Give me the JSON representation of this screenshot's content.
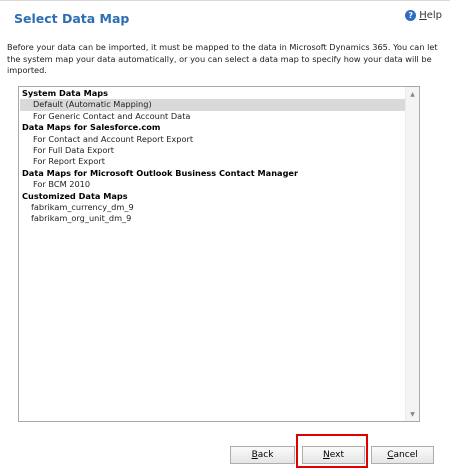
{
  "header": {
    "title": "Select Data Map",
    "help_label": "Help",
    "help_icon": "?"
  },
  "description": "Before your data can be imported, it must be mapped to the data in Microsoft Dynamics 365. You can let the system map your data automatically, or you can select a data map to specify how your data will be imported.",
  "list": {
    "groups": [
      {
        "label": "System Data Maps",
        "items": [
          "Default (Automatic Mapping)",
          "For Generic Contact and Account Data"
        ]
      },
      {
        "label": "Data Maps for Salesforce.com",
        "items": [
          "For Contact and Account Report Export",
          "For Full Data Export",
          "For Report Export"
        ]
      },
      {
        "label": "Data Maps for Microsoft Outlook Business Contact Manager",
        "items": [
          "For BCM 2010"
        ]
      },
      {
        "label": "Customized Data Maps",
        "items": [
          "fabrikam_currency_dm_9",
          "fabrikam_org_unit_dm_9"
        ]
      }
    ],
    "selected_item": "Default (Automatic Mapping)",
    "scroll_up_glyph": "▲",
    "scroll_down_glyph": "▼"
  },
  "buttons": {
    "back_label": "Back",
    "next_label": "Next",
    "cancel_label": "Cancel"
  },
  "colors": {
    "title": "#2e6db4",
    "highlight": "#e00000",
    "selection": "#d9d9d9"
  }
}
